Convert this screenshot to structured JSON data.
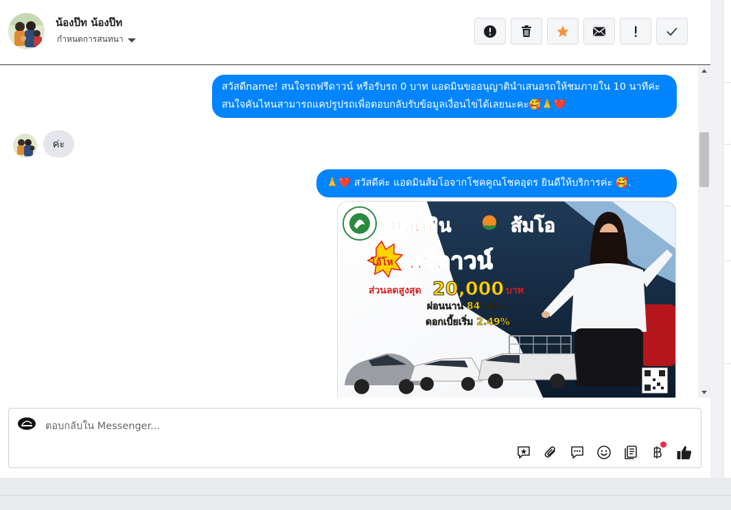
{
  "header": {
    "contact_name": "น้องป๊ท น้องป๊ท",
    "conversation_settings": "กำหนดการสนทนา",
    "actions": [
      {
        "icon": "alert-circle-icon",
        "name": "mark-spam-button"
      },
      {
        "icon": "trash-icon",
        "name": "delete-button"
      },
      {
        "icon": "star-icon",
        "name": "star-button"
      },
      {
        "icon": "envelope-icon",
        "name": "mark-unread-button"
      },
      {
        "icon": "exclamation-icon",
        "name": "follow-up-button"
      },
      {
        "icon": "check-icon",
        "name": "mark-done-button"
      }
    ],
    "star_color": "#f7923b"
  },
  "messages": {
    "m1_text": "สวัสดีname! สนใจรถฟรีดาวน์ หรือรับรถ 0 บาท แอดมินขออนุญาตินำเสนอรถให้ชมภายใน 10 นาทีค่ะ สนใจคันไหนสามารถแคปรูปรถเพื่อตอบกลับรับข้อมูลเงื่อนไขได้เลยนะคะ🥰🙏❤️",
    "m2_text": "ค่ะ",
    "m3_text": "🙏❤️ สวัสดีค่ะ แอดมินส้มโอจากโชคคูณโชคอุดร ยินดีให้บริการค่ะ  🥰.",
    "outgoing_color": "#0084ff"
  },
  "promo": {
    "title_left": "แอดมิน",
    "title_right": "ส้มโอ",
    "badge": "โอ้โห",
    "headline": "ฟรีดาวน์",
    "discount_label": "ส่วนลดสูงสุด",
    "discount_value": "20,000",
    "discount_unit": "บาท",
    "installment": "ผ่อนนาน 84 เดือน",
    "interest": "ดอกเบี้ยเริ่ม 2.49%"
  },
  "composer": {
    "placeholder": "ตอบกลับใน Messenger...",
    "tools": [
      "saved-reply-icon",
      "attachment-icon",
      "chat-bubble-icon",
      "emoji-icon",
      "notes-icon",
      "baht-icon",
      "thumbs-up-icon"
    ]
  }
}
